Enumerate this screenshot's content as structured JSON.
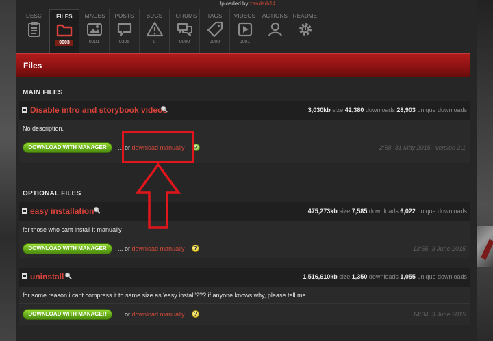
{
  "header": {
    "uploaded_prefix": "Uploaded by",
    "uploader": "zanderb14"
  },
  "tabs": [
    {
      "label": "DESC",
      "count": "",
      "icon": "document-icon",
      "active": false
    },
    {
      "label": "FILES",
      "count": "0003",
      "icon": "folder-icon",
      "active": true
    },
    {
      "label": "IMAGES",
      "count": "0001",
      "icon": "image-icon",
      "active": false
    },
    {
      "label": "POSTS",
      "count": "0305",
      "icon": "speech-bubble-icon",
      "active": false
    },
    {
      "label": "BUGS",
      "count": "0",
      "icon": "warning-icon",
      "active": false
    },
    {
      "label": "FORUMS",
      "count": "0000",
      "icon": "chat-bubbles-icon",
      "active": false
    },
    {
      "label": "TAGS",
      "count": "0000",
      "icon": "tag-icon",
      "active": false
    },
    {
      "label": "VIDEOS",
      "count": "0001",
      "icon": "play-icon",
      "active": false
    },
    {
      "label": "ACTIONS",
      "count": "",
      "icon": "user-icon",
      "active": false
    },
    {
      "label": "README",
      "count": "",
      "icon": "gear-icon",
      "active": false
    }
  ],
  "files_bar": {
    "title": "Files"
  },
  "sections": {
    "main": "MAIN FILES",
    "optional": "OPTIONAL FILES"
  },
  "files": [
    {
      "name": "Disable intro and storybook videos",
      "size": "3,030kb",
      "size_label": "size",
      "downloads": "42,380",
      "downloads_label": "downloads",
      "unique": "28,903",
      "unique_label": "unique downloads",
      "description": "No description.",
      "button": "DOWNLOAD WITH MANAGER",
      "or_text": "... or",
      "manual_link": "download manually",
      "status": "ok",
      "date": "2:58, 31 May 2015",
      "version": "| version 2.1"
    },
    {
      "name": "easy installation",
      "size": "475,273kb",
      "size_label": "size",
      "downloads": "7,585",
      "downloads_label": "downloads",
      "unique": "6,022",
      "unique_label": "unique downloads",
      "description": "for those who cant install it manually",
      "button": "DOWNLOAD WITH MANAGER",
      "or_text": "... or",
      "manual_link": "download manually",
      "status": "warn",
      "date": "13:55, 3 June 2015",
      "version": ""
    },
    {
      "name": "uninstall",
      "size": "1,516,610kb",
      "size_label": "size",
      "downloads": "1,350",
      "downloads_label": "downloads",
      "unique": "1,055",
      "unique_label": "unique downloads",
      "description": "for some reason i cant compress it to same size as 'easy install'??? if anyone knows why, please tell me...",
      "button": "DOWNLOAD WITH MANAGER",
      "or_text": "... or",
      "manual_link": "download manually",
      "status": "warn",
      "date": "14:34, 3 June 2015",
      "version": ""
    }
  ],
  "colors": {
    "accent_red": "#d9423a",
    "files_bar": "#a01818",
    "button_green": "#69b11a"
  }
}
